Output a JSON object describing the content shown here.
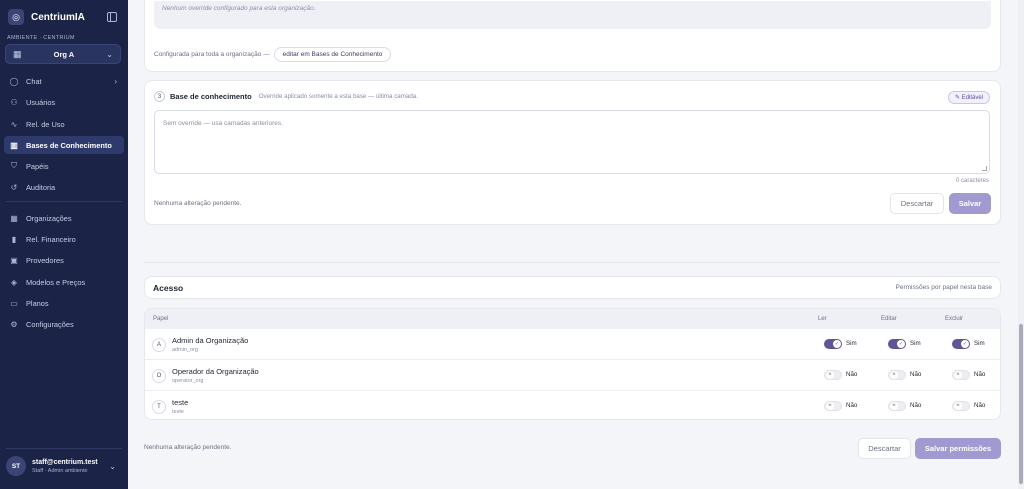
{
  "sidebar": {
    "brand": "CentriumIA",
    "env_label": "AMBIENTE · CENTRIUM",
    "org": "Org A",
    "items": [
      {
        "label": "Chat",
        "icon": "chat-icon"
      },
      {
        "label": "Usuários",
        "icon": "users-icon"
      },
      {
        "label": "Rel. de Uso",
        "icon": "activity-icon"
      },
      {
        "label": "Bases de Conhecimento",
        "icon": "book-icon"
      },
      {
        "label": "Papéis",
        "icon": "shield-icon"
      },
      {
        "label": "Auditoria",
        "icon": "history-icon"
      },
      {
        "label": "Organizações",
        "icon": "building-icon"
      },
      {
        "label": "Rel. Financeiro",
        "icon": "bar-chart-icon"
      },
      {
        "label": "Provedores",
        "icon": "chip-icon"
      },
      {
        "label": "Modelos e Preços",
        "icon": "layers-icon"
      },
      {
        "label": "Planos",
        "icon": "card-icon"
      },
      {
        "label": "Configurações",
        "icon": "settings-icon"
      }
    ],
    "user": {
      "initials": "ST",
      "email": "staff@centrium.test",
      "role": "Staff · Admin ambiente"
    }
  },
  "layer2": {
    "note": "Nenhum override configurado para esta organização.",
    "configured_text": "Configurada para toda a organização —",
    "link": "editar em Bases de Conhecimento"
  },
  "layer3": {
    "step": "3",
    "title": "Base de conhecimento",
    "subtitle": "Override aplicado somente a esta base — última camada.",
    "badge": "Editável",
    "placeholder": "Sem override — usa camadas anteriores.",
    "char_count": "0 caracteres",
    "pending": "Nenhuma alteração pendente.",
    "discard": "Descartar",
    "save": "Salvar"
  },
  "access": {
    "title": "Acesso",
    "subtitle": "Permissões por papel nesta base",
    "columns": [
      "Papel",
      "Ler",
      "Editar",
      "Excluir"
    ],
    "rows": [
      {
        "initial": "A",
        "name": "Admin da Organização",
        "slug": "admin_org",
        "perms": [
          "Sim",
          "Sim",
          "Sim"
        ]
      },
      {
        "initial": "O",
        "name": "Operador da Organização",
        "slug": "operator_org",
        "perms": [
          "Não",
          "Não",
          "Não"
        ]
      },
      {
        "initial": "T",
        "name": "teste",
        "slug": "teste",
        "perms": [
          "Não",
          "Não",
          "Não"
        ]
      }
    ],
    "pending": "Nenhuma alteração pendente.",
    "discard": "Descartar",
    "save": "Salvar permissões"
  }
}
